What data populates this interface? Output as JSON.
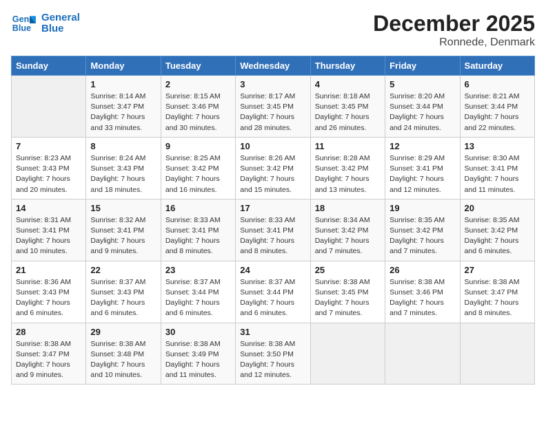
{
  "logo": {
    "line1": "General",
    "line2": "Blue"
  },
  "title": "December 2025",
  "location": "Ronnede, Denmark",
  "days_of_week": [
    "Sunday",
    "Monday",
    "Tuesday",
    "Wednesday",
    "Thursday",
    "Friday",
    "Saturday"
  ],
  "weeks": [
    [
      {
        "day": "",
        "sunrise": "",
        "sunset": "",
        "daylight": ""
      },
      {
        "day": "1",
        "sunrise": "Sunrise: 8:14 AM",
        "sunset": "Sunset: 3:47 PM",
        "daylight": "Daylight: 7 hours and 33 minutes."
      },
      {
        "day": "2",
        "sunrise": "Sunrise: 8:15 AM",
        "sunset": "Sunset: 3:46 PM",
        "daylight": "Daylight: 7 hours and 30 minutes."
      },
      {
        "day": "3",
        "sunrise": "Sunrise: 8:17 AM",
        "sunset": "Sunset: 3:45 PM",
        "daylight": "Daylight: 7 hours and 28 minutes."
      },
      {
        "day": "4",
        "sunrise": "Sunrise: 8:18 AM",
        "sunset": "Sunset: 3:45 PM",
        "daylight": "Daylight: 7 hours and 26 minutes."
      },
      {
        "day": "5",
        "sunrise": "Sunrise: 8:20 AM",
        "sunset": "Sunset: 3:44 PM",
        "daylight": "Daylight: 7 hours and 24 minutes."
      },
      {
        "day": "6",
        "sunrise": "Sunrise: 8:21 AM",
        "sunset": "Sunset: 3:44 PM",
        "daylight": "Daylight: 7 hours and 22 minutes."
      }
    ],
    [
      {
        "day": "7",
        "sunrise": "Sunrise: 8:23 AM",
        "sunset": "Sunset: 3:43 PM",
        "daylight": "Daylight: 7 hours and 20 minutes."
      },
      {
        "day": "8",
        "sunrise": "Sunrise: 8:24 AM",
        "sunset": "Sunset: 3:43 PM",
        "daylight": "Daylight: 7 hours and 18 minutes."
      },
      {
        "day": "9",
        "sunrise": "Sunrise: 8:25 AM",
        "sunset": "Sunset: 3:42 PM",
        "daylight": "Daylight: 7 hours and 16 minutes."
      },
      {
        "day": "10",
        "sunrise": "Sunrise: 8:26 AM",
        "sunset": "Sunset: 3:42 PM",
        "daylight": "Daylight: 7 hours and 15 minutes."
      },
      {
        "day": "11",
        "sunrise": "Sunrise: 8:28 AM",
        "sunset": "Sunset: 3:42 PM",
        "daylight": "Daylight: 7 hours and 13 minutes."
      },
      {
        "day": "12",
        "sunrise": "Sunrise: 8:29 AM",
        "sunset": "Sunset: 3:41 PM",
        "daylight": "Daylight: 7 hours and 12 minutes."
      },
      {
        "day": "13",
        "sunrise": "Sunrise: 8:30 AM",
        "sunset": "Sunset: 3:41 PM",
        "daylight": "Daylight: 7 hours and 11 minutes."
      }
    ],
    [
      {
        "day": "14",
        "sunrise": "Sunrise: 8:31 AM",
        "sunset": "Sunset: 3:41 PM",
        "daylight": "Daylight: 7 hours and 10 minutes."
      },
      {
        "day": "15",
        "sunrise": "Sunrise: 8:32 AM",
        "sunset": "Sunset: 3:41 PM",
        "daylight": "Daylight: 7 hours and 9 minutes."
      },
      {
        "day": "16",
        "sunrise": "Sunrise: 8:33 AM",
        "sunset": "Sunset: 3:41 PM",
        "daylight": "Daylight: 7 hours and 8 minutes."
      },
      {
        "day": "17",
        "sunrise": "Sunrise: 8:33 AM",
        "sunset": "Sunset: 3:41 PM",
        "daylight": "Daylight: 7 hours and 8 minutes."
      },
      {
        "day": "18",
        "sunrise": "Sunrise: 8:34 AM",
        "sunset": "Sunset: 3:42 PM",
        "daylight": "Daylight: 7 hours and 7 minutes."
      },
      {
        "day": "19",
        "sunrise": "Sunrise: 8:35 AM",
        "sunset": "Sunset: 3:42 PM",
        "daylight": "Daylight: 7 hours and 7 minutes."
      },
      {
        "day": "20",
        "sunrise": "Sunrise: 8:35 AM",
        "sunset": "Sunset: 3:42 PM",
        "daylight": "Daylight: 7 hours and 6 minutes."
      }
    ],
    [
      {
        "day": "21",
        "sunrise": "Sunrise: 8:36 AM",
        "sunset": "Sunset: 3:43 PM",
        "daylight": "Daylight: 7 hours and 6 minutes."
      },
      {
        "day": "22",
        "sunrise": "Sunrise: 8:37 AM",
        "sunset": "Sunset: 3:43 PM",
        "daylight": "Daylight: 7 hours and 6 minutes."
      },
      {
        "day": "23",
        "sunrise": "Sunrise: 8:37 AM",
        "sunset": "Sunset: 3:44 PM",
        "daylight": "Daylight: 7 hours and 6 minutes."
      },
      {
        "day": "24",
        "sunrise": "Sunrise: 8:37 AM",
        "sunset": "Sunset: 3:44 PM",
        "daylight": "Daylight: 7 hours and 6 minutes."
      },
      {
        "day": "25",
        "sunrise": "Sunrise: 8:38 AM",
        "sunset": "Sunset: 3:45 PM",
        "daylight": "Daylight: 7 hours and 7 minutes."
      },
      {
        "day": "26",
        "sunrise": "Sunrise: 8:38 AM",
        "sunset": "Sunset: 3:46 PM",
        "daylight": "Daylight: 7 hours and 7 minutes."
      },
      {
        "day": "27",
        "sunrise": "Sunrise: 8:38 AM",
        "sunset": "Sunset: 3:47 PM",
        "daylight": "Daylight: 7 hours and 8 minutes."
      }
    ],
    [
      {
        "day": "28",
        "sunrise": "Sunrise: 8:38 AM",
        "sunset": "Sunset: 3:47 PM",
        "daylight": "Daylight: 7 hours and 9 minutes."
      },
      {
        "day": "29",
        "sunrise": "Sunrise: 8:38 AM",
        "sunset": "Sunset: 3:48 PM",
        "daylight": "Daylight: 7 hours and 10 minutes."
      },
      {
        "day": "30",
        "sunrise": "Sunrise: 8:38 AM",
        "sunset": "Sunset: 3:49 PM",
        "daylight": "Daylight: 7 hours and 11 minutes."
      },
      {
        "day": "31",
        "sunrise": "Sunrise: 8:38 AM",
        "sunset": "Sunset: 3:50 PM",
        "daylight": "Daylight: 7 hours and 12 minutes."
      },
      {
        "day": "",
        "sunrise": "",
        "sunset": "",
        "daylight": ""
      },
      {
        "day": "",
        "sunrise": "",
        "sunset": "",
        "daylight": ""
      },
      {
        "day": "",
        "sunrise": "",
        "sunset": "",
        "daylight": ""
      }
    ]
  ]
}
